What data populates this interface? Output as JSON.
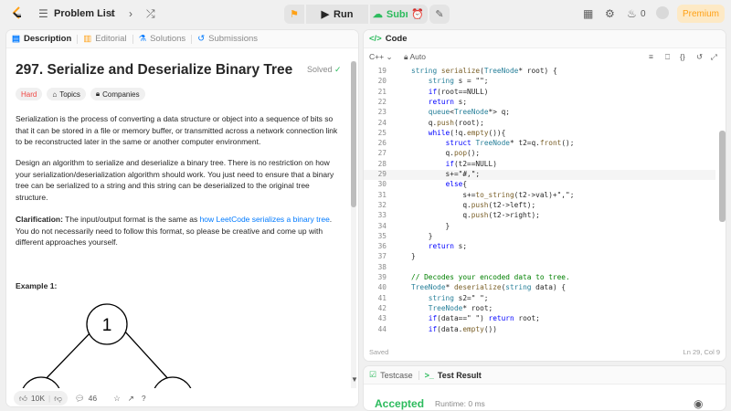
{
  "topbar": {
    "problem_list_label": "Problem List",
    "run_label": "Run",
    "submit_label": "Submit",
    "notif_count": "0",
    "premium_label": "Premium"
  },
  "left": {
    "tabs": [
      {
        "label": "Description"
      },
      {
        "label": "Editorial"
      },
      {
        "label": "Solutions"
      },
      {
        "label": "Submissions"
      }
    ],
    "title": "297. Serialize and Deserialize Binary Tree",
    "solved": "Solved",
    "tags": {
      "difficulty": "Hard",
      "topics": "Topics",
      "companies": "Companies"
    },
    "para1": "Serialization is the process of converting a data structure or object into a sequence of bits so that it can be stored in a file or memory buffer, or transmitted across a network connection link to be reconstructed later in the same or another computer environment.",
    "para2": "Design an algorithm to serialize and deserialize a binary tree. There is no restriction on how your serialization/deserialization algorithm should work. You just need to ensure that a binary tree can be serialized to a string and this string can be deserialized to the original tree structure.",
    "clar_label": "Clarification:",
    "clar_text1": " The input/output format is the same as ",
    "clar_link": "how LeetCode serializes a binary tree",
    "clar_text2": ". You do not necessarily need to follow this format, so please be creative and come up with different approaches yourself.",
    "example_title": "Example 1:",
    "tree_root": "1",
    "likes": "10K",
    "comments": "46"
  },
  "right": {
    "code_tab": "Code",
    "language": "C++",
    "auto": "Auto",
    "saved": "Saved",
    "cursor": "Ln 29, Col 9",
    "testcase_tab": "Testcase",
    "result_tab": "Test Result",
    "accepted": "Accepted",
    "runtime": "Runtime: 0 ms"
  },
  "code_lines": [
    {
      "n": "19",
      "t": "string serialize(TreeNode* root) {"
    },
    {
      "n": "20",
      "t": "    string s = \"\";"
    },
    {
      "n": "21",
      "t": "    if(root==NULL)"
    },
    {
      "n": "22",
      "t": "    return s;"
    },
    {
      "n": "23",
      "t": "    queue<TreeNode*> q;"
    },
    {
      "n": "24",
      "t": "    q.push(root);"
    },
    {
      "n": "25",
      "t": "    while(!q.empty()){"
    },
    {
      "n": "26",
      "t": "        struct TreeNode* t2=q.front();"
    },
    {
      "n": "27",
      "t": "        q.pop();"
    },
    {
      "n": "28",
      "t": "        if(t2==NULL)"
    },
    {
      "n": "29",
      "t": "        s+=\"#,\";"
    },
    {
      "n": "30",
      "t": "        else{"
    },
    {
      "n": "31",
      "t": "            s+=to_string(t2->val)+\",\";"
    },
    {
      "n": "32",
      "t": "            q.push(t2->left);"
    },
    {
      "n": "33",
      "t": "            q.push(t2->right);"
    },
    {
      "n": "34",
      "t": "        }"
    },
    {
      "n": "35",
      "t": "    }"
    },
    {
      "n": "36",
      "t": "    return s;"
    },
    {
      "n": "37",
      "t": "}"
    },
    {
      "n": "38",
      "t": ""
    },
    {
      "n": "39",
      "t": "// Decodes your encoded data to tree."
    },
    {
      "n": "40",
      "t": "TreeNode* deserialize(string data) {"
    },
    {
      "n": "41",
      "t": "    string s2=\" \";"
    },
    {
      "n": "42",
      "t": "    TreeNode* root;"
    },
    {
      "n": "43",
      "t": "    if(data==\" \") return root;"
    },
    {
      "n": "44",
      "t": "    if(data.empty())"
    }
  ]
}
